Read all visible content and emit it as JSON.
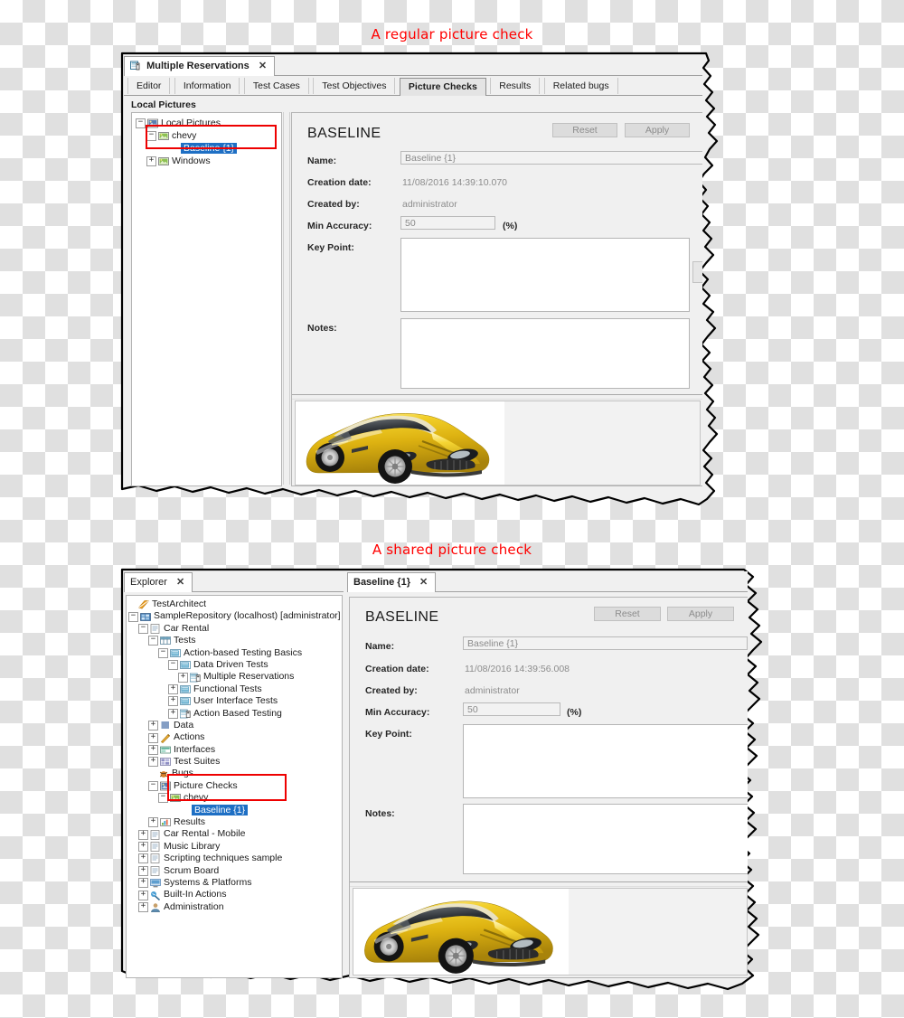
{
  "captions": {
    "top": "A regular picture check",
    "bottom": "A shared picture check",
    "color": "#ff0000"
  },
  "panel1": {
    "window_tab": {
      "title": "Multiple Reservations",
      "close": "✕",
      "icon": "test-module-icon"
    },
    "tabs": [
      {
        "label": "Editor",
        "selected": false
      },
      {
        "label": "Information",
        "selected": false
      },
      {
        "label": "Test Cases",
        "selected": false
      },
      {
        "label": "Test Objectives",
        "selected": false
      },
      {
        "label": "Picture Checks",
        "selected": true
      },
      {
        "label": "Results",
        "selected": false
      },
      {
        "label": "Related bugs",
        "selected": false
      }
    ],
    "tree_header": "Local Pictures",
    "tree": [
      {
        "label": "Local Pictures",
        "depth": 0,
        "expander": "−",
        "icon": "pictures-root-icon",
        "selected": false
      },
      {
        "label": "chevy",
        "depth": 1,
        "expander": "−",
        "icon": "picture-folder-icon",
        "selected": false
      },
      {
        "label": "Baseline {1}",
        "depth": 2,
        "expander": "",
        "icon": "",
        "selected": true
      },
      {
        "label": "Windows",
        "depth": 1,
        "expander": "+",
        "icon": "picture-folder-icon",
        "selected": false
      }
    ],
    "form": {
      "title": "BASELINE",
      "reset_label": "Reset",
      "apply_label": "Apply",
      "name_label": "Name:",
      "name_value": "Baseline {1}",
      "creation_label": "Creation date:",
      "creation_value": "11/08/2016 14:39:10.070",
      "createdby_label": "Created by:",
      "createdby_value": "administrator",
      "accuracy_label": "Min Accuracy:",
      "accuracy_value": "50",
      "accuracy_unit": "(%)",
      "keypoint_label": "Key Point:",
      "keypoint_value": "",
      "notes_label": "Notes:",
      "notes_value": ""
    },
    "preview": {
      "alt": "yellow-sports-car-baseline-image"
    }
  },
  "panel2": {
    "explorer_tab": {
      "title": "Explorer",
      "close": "✕"
    },
    "document_tab": {
      "title": "Baseline {1}",
      "close": "✕"
    },
    "tree": [
      {
        "label": "TestArchitect",
        "depth": 0,
        "expander": "",
        "icon": "testarchitect-icon",
        "selected": false
      },
      {
        "label": "SampleRepository (localhost) [administrator]",
        "depth": 0,
        "expander": "−",
        "icon": "repository-icon",
        "selected": false
      },
      {
        "label": "Car Rental",
        "depth": 1,
        "expander": "−",
        "icon": "project-icon",
        "selected": false
      },
      {
        "label": "Tests",
        "depth": 2,
        "expander": "−",
        "icon": "tests-icon",
        "selected": false
      },
      {
        "label": "Action-based Testing Basics",
        "depth": 3,
        "expander": "−",
        "icon": "test-module-folder-icon",
        "selected": false
      },
      {
        "label": "Data Driven Tests",
        "depth": 4,
        "expander": "−",
        "icon": "test-module-folder-icon",
        "selected": false
      },
      {
        "label": "Multiple Reservations",
        "depth": 5,
        "expander": "+",
        "icon": "test-module-icon",
        "selected": false
      },
      {
        "label": "Functional Tests",
        "depth": 4,
        "expander": "+",
        "icon": "test-module-folder-icon",
        "selected": false
      },
      {
        "label": "User Interface Tests",
        "depth": 4,
        "expander": "+",
        "icon": "test-module-folder-icon",
        "selected": false
      },
      {
        "label": "Action Based Testing",
        "depth": 4,
        "expander": "+",
        "icon": "test-module-icon",
        "selected": false
      },
      {
        "label": "Data",
        "depth": 2,
        "expander": "+",
        "icon": "data-icon",
        "selected": false
      },
      {
        "label": "Actions",
        "depth": 2,
        "expander": "+",
        "icon": "actions-icon",
        "selected": false
      },
      {
        "label": "Interfaces",
        "depth": 2,
        "expander": "+",
        "icon": "interfaces-icon",
        "selected": false
      },
      {
        "label": "Test Suites",
        "depth": 2,
        "expander": "+",
        "icon": "test-suites-icon",
        "selected": false
      },
      {
        "label": "Bugs",
        "depth": 2,
        "expander": "",
        "icon": "bugs-icon",
        "selected": false
      },
      {
        "label": "Picture Checks",
        "depth": 2,
        "expander": "−",
        "icon": "pictures-root-icon",
        "selected": false
      },
      {
        "label": "chevy",
        "depth": 3,
        "expander": "−",
        "icon": "picture-folder-icon",
        "selected": false
      },
      {
        "label": "Baseline {1}",
        "depth": 4,
        "expander": "",
        "icon": "",
        "selected": true
      },
      {
        "label": "Results",
        "depth": 2,
        "expander": "+",
        "icon": "results-icon",
        "selected": false
      },
      {
        "label": "Car Rental - Mobile",
        "depth": 1,
        "expander": "+",
        "icon": "project-icon",
        "selected": false
      },
      {
        "label": "Music Library",
        "depth": 1,
        "expander": "+",
        "icon": "project-icon",
        "selected": false
      },
      {
        "label": "Scripting techniques sample",
        "depth": 1,
        "expander": "+",
        "icon": "project-icon",
        "selected": false
      },
      {
        "label": "Scrum Board",
        "depth": 1,
        "expander": "+",
        "icon": "project-icon",
        "selected": false
      },
      {
        "label": "Systems & Platforms",
        "depth": 1,
        "expander": "+",
        "icon": "systems-platforms-icon",
        "selected": false
      },
      {
        "label": "Built-In Actions",
        "depth": 1,
        "expander": "+",
        "icon": "builtin-actions-icon",
        "selected": false
      },
      {
        "label": "Administration",
        "depth": 1,
        "expander": "+",
        "icon": "administration-icon",
        "selected": false
      }
    ],
    "form": {
      "title": "BASELINE",
      "reset_label": "Reset",
      "apply_label": "Apply",
      "name_label": "Name:",
      "name_value": "Baseline {1}",
      "creation_label": "Creation date:",
      "creation_value": "11/08/2016 14:39:56.008",
      "createdby_label": "Created by:",
      "createdby_value": "administrator",
      "accuracy_label": "Min Accuracy:",
      "accuracy_value": "50",
      "accuracy_unit": "(%)",
      "keypoint_label": "Key Point:",
      "keypoint_value": "",
      "notes_label": "Notes:",
      "notes_value": ""
    },
    "preview": {
      "alt": "yellow-sports-car-baseline-image"
    }
  }
}
